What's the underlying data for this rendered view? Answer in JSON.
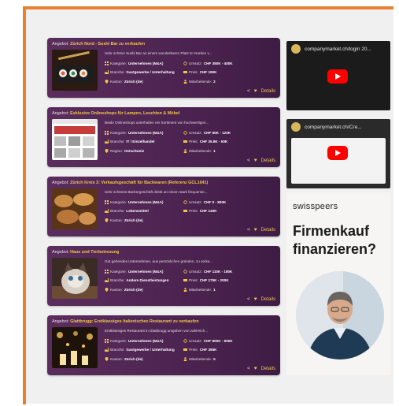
{
  "colors": {
    "accent_frame": "#e8812d",
    "card_bg": "#4c2350",
    "title_highlight": "#f0c64a"
  },
  "listings": [
    {
      "label": "Angebot:",
      "title": "Zürich Nord - Sushi Bar zu verkaufen",
      "desc": "Sehr schöne Sushi Bar an einem wunderbaren Platz im Norden v...",
      "c1r1_k": "Kategorie:",
      "c1r1_v": "Unternehmen (M&A)",
      "c1r2_k": "Branche:",
      "c1r2_v": "Gastgewerbe / Unterhaltung",
      "c1r3_k": "Kanton:",
      "c1r3_v": "Zürich (de)",
      "c2r1_k": "Umsatz:",
      "c2r1_v": "CHF 350K - 400K",
      "c2r2_k": "Preis:",
      "c2r2_v": "CHF 190K",
      "c2r3_k": "Mitarbeitende:",
      "c2r3_v": "2",
      "details": "Details",
      "thumb": "sushi-photo"
    },
    {
      "label": "Angebot:",
      "title": "Exklusive Onlineshops für Lampen, Leuchten & Möbel",
      "desc": "Beide Onlineshops unterhalten ein Sortiment von hochwertigen...",
      "c1r1_k": "Kategorie:",
      "c1r1_v": "Unternehmen (M&A)",
      "c1r2_k": "Branche:",
      "c1r2_v": "IT / Einzelhandel",
      "c1r3_k": "Region:",
      "c1r3_v": "Ostschweiz",
      "c2r1_k": "Umsatz:",
      "c2r1_v": "CHF 60K - 120K",
      "c2r2_k": "Preis:",
      "c2r2_v": "CHF 35.8K - 50K",
      "c2r3_k": "Mitarbeitende:",
      "c2r3_v": "1",
      "details": "Details",
      "thumb": "webshop-screenshot"
    },
    {
      "label": "Angebot:",
      "title": "Zürich Kreis 3: Verkaufsgeschäft für Backwaren (Referenz GCL1041)",
      "desc": "Sehr schönes Bäckergeschäft direkt an einem stark frequentie...",
      "c1r1_k": "Kategorie:",
      "c1r1_v": "Unternehmen (M&A)",
      "c1r2_k": "Branche:",
      "c1r2_v": "Lebensmittel",
      "c1r3_k": "Kanton:",
      "c1r3_v": "Zürich (de)",
      "c2r1_k": "Umsatz:",
      "c2r1_v": "CHF 0 - 800K",
      "c2r2_k": "Preis:",
      "c2r2_v": "CHF 140K",
      "c2r3_k": "",
      "c2r3_v": "",
      "details": "Details",
      "thumb": "bread-photo"
    },
    {
      "label": "Angebot:",
      "title": "Haus und Tierbetreuung",
      "desc": "Gut gehendes Unternehmen, aus persönlichen gründen, zu verka...",
      "c1r1_k": "Kategorie:",
      "c1r1_v": "Unternehmen (M&A)",
      "c1r2_k": "Branche:",
      "c1r2_v": "Andere Dienstleistungen",
      "c1r3_k": "Kanton:",
      "c1r3_v": "Zürich (de)",
      "c2r1_k": "Umsatz:",
      "c2r1_v": "CHF 110K - 180K",
      "c2r2_k": "Preis:",
      "c2r2_v": "CHF 175K - 200K",
      "c2r3_k": "Mitarbeitende:",
      "c2r3_v": "1",
      "details": "Details",
      "thumb": "cat-photo"
    },
    {
      "label": "Angebot:",
      "title": "Glattbrugg: Erstklassiges italienisches Restaurant zu verkaufen",
      "desc": "Erstklassiges Restaurant in Glattbrugg umgeben von zahlreich...",
      "c1r1_k": "Kategorie:",
      "c1r1_v": "Unternehmen (M&A)",
      "c1r2_k": "Branche:",
      "c1r2_v": "Gastgewerbe / Unterhaltung",
      "c1r3_k": "Kanton:",
      "c1r3_v": "Zürich (de)",
      "c2r1_k": "Umsatz:",
      "c2r1_v": "CHF 600K - 900K",
      "c2r2_k": "Preis:",
      "c2r2_v": "CHF 395K",
      "c2r3_k": "Mitarbeitende:",
      "c2r3_v": "5",
      "details": "Details",
      "thumb": "restaurant-photo"
    }
  ],
  "videos": [
    {
      "title": "companymarket.ch/login 20...",
      "icon": "youtube-play-icon"
    },
    {
      "title": "companymarket.ch/Cre...",
      "icon": "youtube-play-icon"
    }
  ],
  "ad": {
    "brand": "swisspeers",
    "headline_1": "Firmenkauf",
    "headline_2": "finanzieren?"
  }
}
